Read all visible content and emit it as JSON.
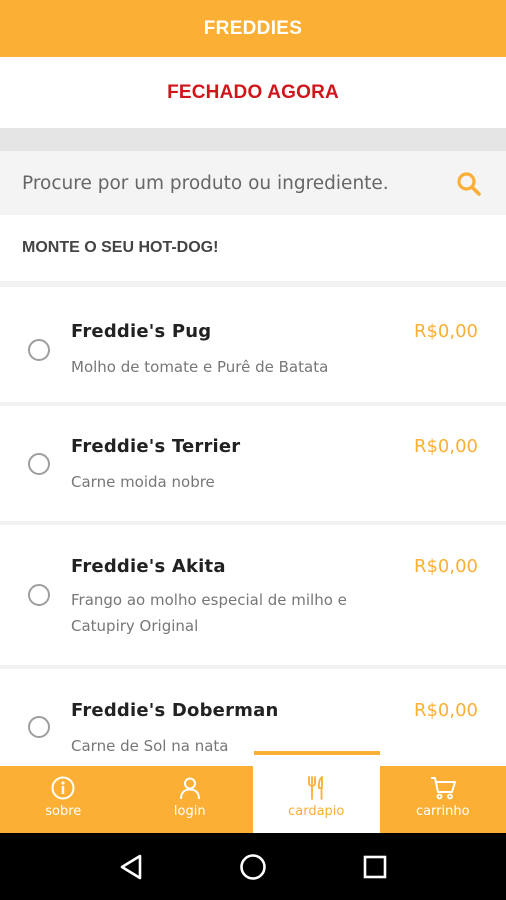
{
  "header": {
    "title": "FREDDIES"
  },
  "status": {
    "text": "FECHADO AGORA",
    "color": "#D0161B"
  },
  "search": {
    "placeholder": "Procure por um produto ou ingrediente.",
    "value": "",
    "icon": "search-icon"
  },
  "section": {
    "title": "MONTE O SEU HOT-DOG!"
  },
  "products": [
    {
      "name": "Freddie's Pug",
      "price": "R$0,00",
      "description": "Molho de tomate e Purê de Batata"
    },
    {
      "name": "Freddie's Terrier",
      "price": "R$0,00",
      "description": "Carne moida nobre"
    },
    {
      "name": "Freddie's Akita",
      "price": "R$0,00",
      "description": "Frango ao molho especial de milho e Catupiry Original"
    },
    {
      "name": "Freddie's Doberman",
      "price": "R$0,00",
      "description": "Carne de Sol na nata"
    }
  ],
  "tabs": [
    {
      "label": "sobre",
      "icon": "info-icon",
      "active": false
    },
    {
      "label": "login",
      "icon": "user-icon",
      "active": false
    },
    {
      "label": "cardapio",
      "icon": "cutlery-icon",
      "active": true
    },
    {
      "label": "carrinho",
      "icon": "cart-icon",
      "active": false
    }
  ],
  "colors": {
    "accent": "#FBAF34",
    "closed": "#D0161B",
    "text_dark": "#222222",
    "text_muted": "#777777"
  },
  "system_nav": {
    "back_icon": "back-triangle-icon",
    "home_icon": "home-circle-icon",
    "recents_icon": "recents-square-icon"
  }
}
